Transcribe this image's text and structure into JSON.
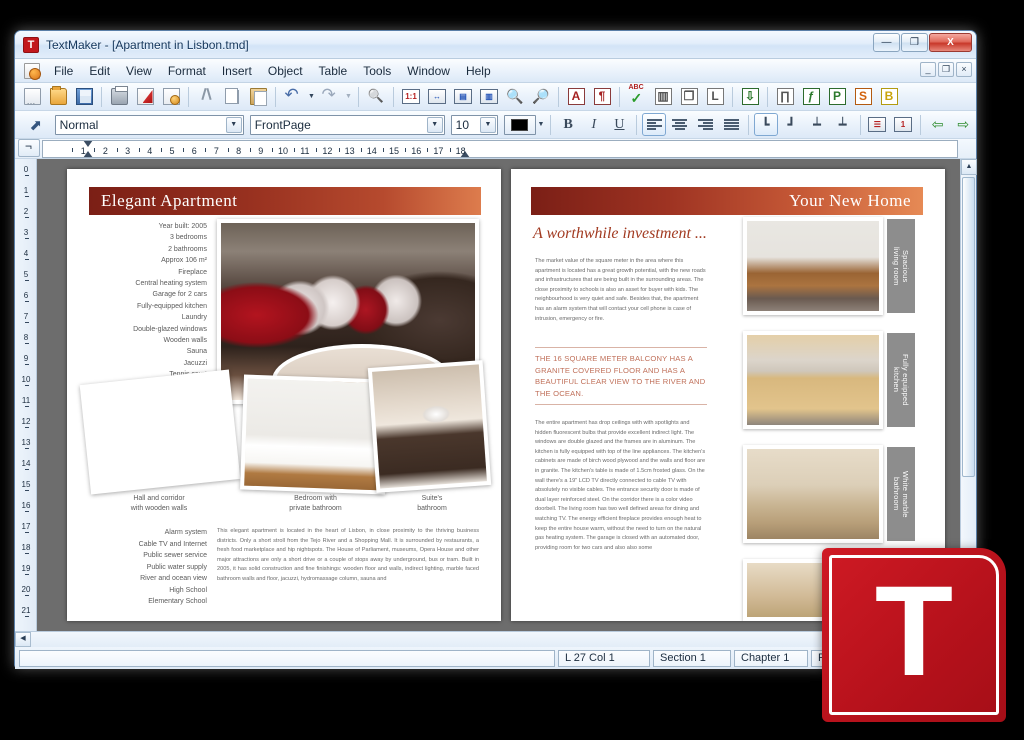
{
  "window": {
    "app_icon_letter": "T",
    "title": "TextMaker - [Apartment in Lisbon.tmd]",
    "minimize": "—",
    "maximize": "❐",
    "close": "X",
    "mdi_minimize": "_",
    "mdi_restore": "❐",
    "mdi_close": "×"
  },
  "menubar": {
    "items": [
      "File",
      "Edit",
      "View",
      "Format",
      "Insert",
      "Object",
      "Table",
      "Tools",
      "Window",
      "Help"
    ]
  },
  "toolbar_standard": {
    "icons": [
      "new-document-icon",
      "open-folder-icon",
      "save-icon",
      "print-icon",
      "export-pdf-icon",
      "print-preview-icon",
      "cut-icon",
      "copy-icon",
      "paste-icon",
      "undo-icon",
      "undo-dropdown-icon",
      "redo-icon",
      "redo-dropdown-icon",
      "find-icon",
      "zoom-100-icon",
      "zoom-page-width-icon",
      "zoom-whole-page-icon",
      "zoom-two-pages-icon",
      "zoom-in-icon",
      "zoom-percent-icon",
      "character-format-icon",
      "paragraph-format-icon",
      "spell-check-icon",
      "chart-icon",
      "object-order-icon",
      "text-frame-icon",
      "import-icon",
      "formula-icon",
      "function-icon",
      "presentations-icon",
      "planmaker-icon",
      "basic-icon"
    ],
    "zoom_100_label": "1:1",
    "char_format_label": "A",
    "presentations_label": "P",
    "planmaker_label": "S",
    "basic_label": "B",
    "text_frame_label": "L",
    "spell_check_label": "ABC"
  },
  "toolbar_format": {
    "pointer_icon": "select-pointer-icon",
    "paragraph_style": "Normal",
    "character_style": "FrontPage",
    "font_size": "10",
    "font_color": "#000000",
    "bold_label": "B",
    "italic_label": "I",
    "underline_label": "U",
    "align_icons": [
      "align-left-icon",
      "align-center-icon",
      "align-right-icon",
      "align-justify-icon"
    ],
    "tab_icons": [
      "tab-left-icon",
      "tab-right-icon",
      "tab-center-icon",
      "tab-decimal-icon"
    ],
    "list_icons": [
      "bullet-list-icon",
      "numbered-list-icon"
    ],
    "indent_icons": [
      "decrease-indent-icon",
      "increase-indent-icon"
    ],
    "numbered_list_label": "1"
  },
  "ruler": {
    "tab_selector_icon": "tab-stop-selector-icon",
    "horizontal_ticks": [
      "1",
      "2",
      "3",
      "4",
      "5",
      "6",
      "7",
      "8",
      "9",
      "10",
      "11",
      "12",
      "13",
      "14",
      "15",
      "16",
      "17",
      "18"
    ],
    "vertical_ticks": [
      "0",
      "1",
      "2",
      "3",
      "4",
      "5",
      "6",
      "7",
      "8",
      "9",
      "10",
      "11",
      "12",
      "13",
      "14",
      "15",
      "16",
      "17",
      "18",
      "19",
      "20",
      "21"
    ]
  },
  "statusbar": {
    "message": "",
    "cursor_position": "L 27 Col 1",
    "section": "Section 1",
    "chapter": "Chapter 1",
    "page": "Page 1 of 2"
  },
  "document": {
    "left_page": {
      "banner_title": "Elegant Apartment",
      "features": [
        "Year built: 2005",
        "3 bedrooms",
        "2 bathrooms",
        "Approx 106 m²",
        "Fireplace",
        "Central heating system",
        "Garage for 2 cars",
        "Fully-equipped kitchen",
        "Laundry",
        "Double-glazed windows",
        "Wooden walls",
        "Sauna",
        "Jacuzzi",
        "Tennis court"
      ],
      "amenities": [
        "Alarm system",
        "Cable TV and Internet",
        "Public sewer service",
        "Public water supply",
        "River and ocean view",
        "High School",
        "Elementary School"
      ],
      "body_text": "This elegant apartment is located in the heart of Lisbon, in close proximity to the thriving business districts. Only a short stroll from the Tejo River and a Shopping Mall. It is surrounded by restaurants, a fresh food marketplace and hip nightspots. The House of Parliament, museums, Opera House and other major attractions are only a short drive or a couple of stops away by underground, bus or tram. Built in 2005, it has solid construction and fine finishings: wooden floor and walls, indirect lighting, marble faced bathroom walls and floor, jacuzzi, hydromassage column, sauna and",
      "photo_captions": [
        "Hall and corridor\nwith wooden walls",
        "Bedroom with\nprivate bathroom",
        "Suite's\nbathroom"
      ],
      "photo_names": [
        "living-room-photo",
        "bowl-photo",
        "hall-corridor-photo",
        "bedroom-photo",
        "suite-bathroom-photo"
      ]
    },
    "right_page": {
      "banner_title": "Your New Home",
      "subheading": "A worthwhile investment ...",
      "paragraph_1": "The market value of the square meter in the area where this apartment is located has a great growth potential, with the new roads and infrastructures that are being built in the surrounding areas. The close proximity to schools is also an asset for buyer with kids. The neighbourhood is very quiet and safe. Besides that, the apartment has an alarm system that will contact your cell phone is case of intrusion, emergency or fire.",
      "highlight": "THE 16 SQUARE METER BALCONY HAS A GRANITE COVERED FLOOR AND HAS A BEAUTIFUL CLEAR VIEW TO THE RIVER AND THE OCEAN.",
      "paragraph_2": "The entire apartment has drop ceilings with with spotlights and hidden fluorescent bulbs that provide excellent indirect light. The windows are double glazed and the frames are in aluminum. The kitchen is fully equipped with top of the line appliances. The kitchen's cabinets are made of birch wood plywood and the walls and floor are in granite. The kitchen's table is made of 1.5cm frosted glass. On the wall there's a 19\" LCD TV directly connected to cable TV with absolutely no visible cables. The entrance security door is made of dual layer reinforced steel. On the corridor there is a color video doorbell. The living room has two well defined areas for dining and watching TV. The energy efficient fireplace provides enough heat to keep the entire house warm, without the need to turn on the natural gas heating system. The garage is closed with an automated door, providing room for two cars and also also some",
      "thumb_captions": [
        "Spacious\nliving room",
        "Fully equipped\nkitchen",
        "White marble\nbathroom"
      ],
      "thumb_names": [
        "living-room-thumb",
        "kitchen-thumb",
        "bathroom-thumb",
        "partial-thumb"
      ]
    }
  },
  "branding": {
    "logo_letter": "T"
  },
  "colors": {
    "accent_red": "#c2181d",
    "banner_dark": "#7b1f16",
    "banner_light": "#e68a55",
    "highlight_text": "#c0705a",
    "heading_text": "#a23b22"
  }
}
